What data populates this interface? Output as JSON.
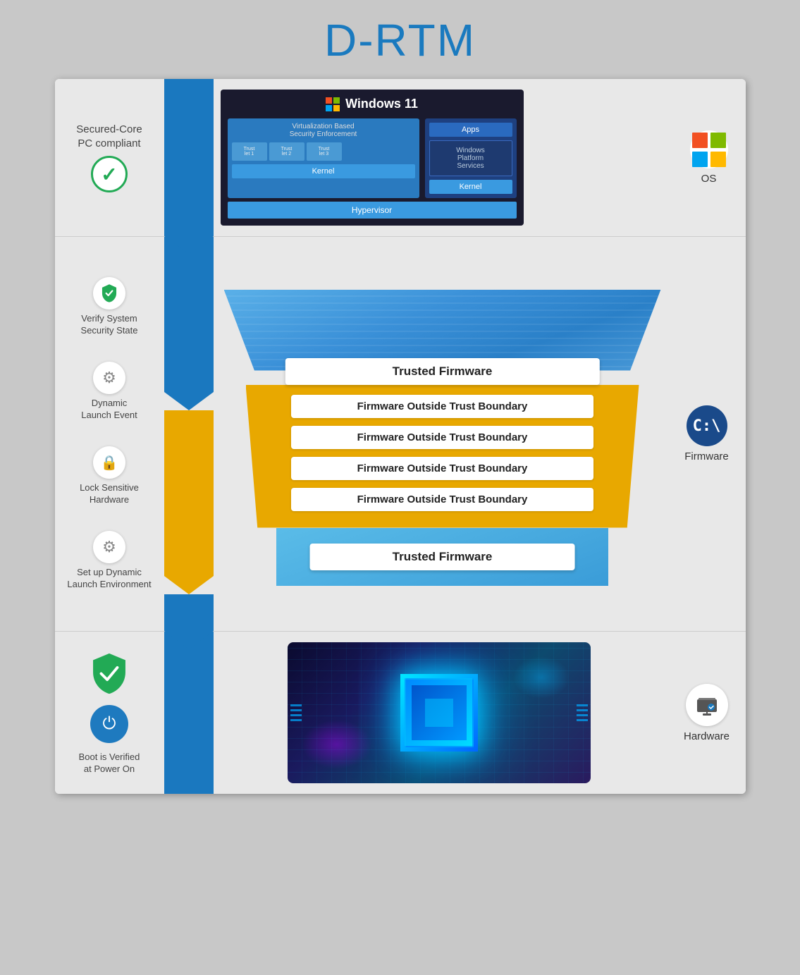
{
  "title": "D-RTM",
  "sections": {
    "os": {
      "left_label": "Secured-Core\nPC compliant",
      "windows_title": "Windows 11",
      "vbs_label": "Virtualization Based\nSecurity Enforcement",
      "apps_label": "Apps",
      "platform_label": "Windows\nPlatform\nServices",
      "kernel_label": "Kernel",
      "hypervisor_label": "Hypervisor",
      "right_icon_label": "OS"
    },
    "firmware": {
      "steps": [
        {
          "icon": "shield-check",
          "label": "Verify System\nSecurity State"
        },
        {
          "icon": "gear",
          "label": "Dynamic\nLaunch Event"
        },
        {
          "icon": "lock",
          "label": "Lock Sensitive\nHardware"
        },
        {
          "icon": "gear",
          "label": "Set up Dynamic\nLaunch Environment"
        }
      ],
      "trusted_firmware_top": "Trusted Firmware",
      "outside_trust_labels": [
        "Firmware Outside Trust Boundary",
        "Firmware Outside Trust Boundary",
        "Firmware Outside Trust Boundary",
        "Firmware Outside Trust Boundary"
      ],
      "trusted_firmware_bottom": "Trusted Firmware",
      "right_icon_label": "Firmware",
      "cmd_text": "C:\\"
    },
    "hardware": {
      "boot_label": "Boot is Verified\nat Power On",
      "right_icon_label": "Hardware"
    }
  }
}
